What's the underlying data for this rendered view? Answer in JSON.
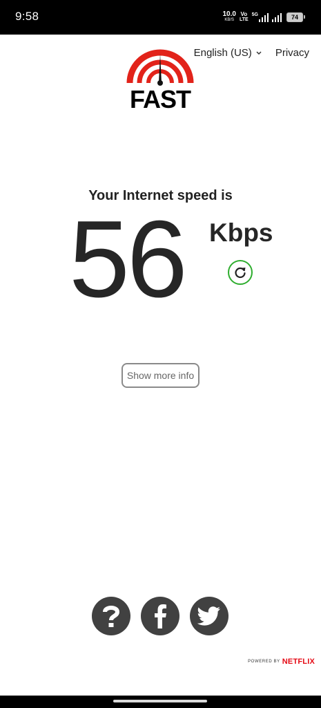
{
  "status_bar": {
    "time": "9:58",
    "net_speed": "10.0",
    "net_speed_unit": "KB/S",
    "volte_top": "Vo",
    "volte_bottom": "LTE",
    "signal_label": "5G",
    "battery": "74"
  },
  "header": {
    "logo_text": "FAST",
    "language": "English (US)",
    "privacy": "Privacy"
  },
  "result": {
    "label": "Your Internet speed is",
    "value": "56",
    "unit": "Kbps"
  },
  "more_info": {
    "label": "Show more info"
  },
  "footer": {
    "powered_by": "POWERED BY",
    "brand": "NETFLIX"
  },
  "colors": {
    "logo_red": "#e2231a",
    "refresh_green": "#2ead2e",
    "social_gray": "#414141",
    "netflix_red": "#e50914"
  },
  "icons": {
    "refresh": "refresh-icon",
    "help": "question-mark-icon",
    "facebook": "facebook-icon",
    "twitter": "twitter-icon"
  }
}
